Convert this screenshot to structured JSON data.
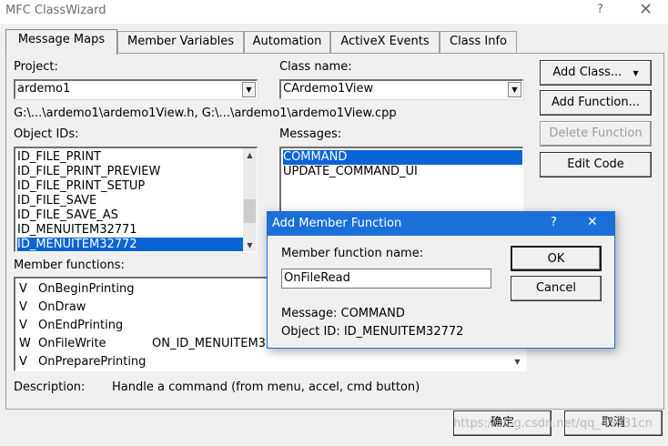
{
  "window": {
    "title": "MFC ClassWizard",
    "help_glyph": "?",
    "close_glyph": "✕"
  },
  "tabs": [
    "Message Maps",
    "Member Variables",
    "Automation",
    "ActiveX Events",
    "Class Info"
  ],
  "project": {
    "label": "Project:",
    "value": "ardemo1"
  },
  "class_name": {
    "label": "Class name:",
    "value": "CArdemo1View"
  },
  "path_text": "G:\\...\\ardemo1\\ardemo1View.h, G:\\...\\ardemo1\\ardemo1View.cpp",
  "object_ids": {
    "label": "Object IDs:",
    "items": [
      "ID_FILE_PRINT",
      "ID_FILE_PRINT_PREVIEW",
      "ID_FILE_PRINT_SETUP",
      "ID_FILE_SAVE",
      "ID_FILE_SAVE_AS",
      "ID_MENUITEM32771",
      "ID_MENUITEM32772"
    ],
    "selected": "ID_MENUITEM32772"
  },
  "messages": {
    "label": "Messages:",
    "items": [
      "COMMAND",
      "UPDATE_COMMAND_UI"
    ],
    "selected": "COMMAND"
  },
  "member_functions": {
    "label": "Member functions:",
    "items": [
      {
        "flag": "V",
        "name": "OnBeginPrinting",
        "handler": ""
      },
      {
        "flag": "V",
        "name": "OnDraw",
        "handler": ""
      },
      {
        "flag": "V",
        "name": "OnEndPrinting",
        "handler": ""
      },
      {
        "flag": "W",
        "name": "OnFileWrite",
        "handler": "ON_ID_MENUITEM3"
      },
      {
        "flag": "V",
        "name": "OnPreparePrinting",
        "handler": ""
      }
    ]
  },
  "buttons": {
    "add_class": "Add Class...",
    "add_function": "Add Function...",
    "delete_function": "Delete Function",
    "edit_code": "Edit Code",
    "ok": "确定",
    "cancel": "取消"
  },
  "description": {
    "label": "Description:",
    "text": "Handle a command (from menu, accel, cmd button)"
  },
  "dialog": {
    "title": "Add Member Function",
    "help_glyph": "?",
    "close_glyph": "✕",
    "name_label": "Member function name:",
    "name_value": "OnFileRead",
    "message_text": "Message: COMMAND",
    "object_id_text": "Object ID: ID_MENUITEM32772",
    "ok": "OK",
    "cancel": "Cancel"
  },
  "watermark": "https://blog.csdn.net/qq_45831cn"
}
